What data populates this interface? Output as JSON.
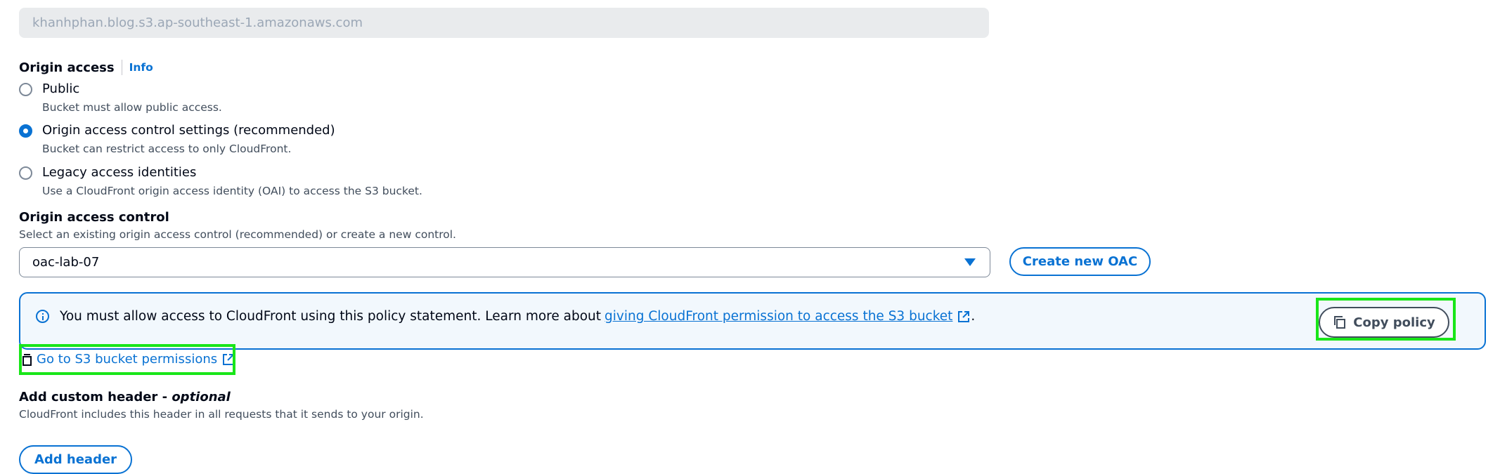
{
  "origin_domain": {
    "value": "khanhphan.blog.s3.ap-southeast-1.amazonaws.com"
  },
  "origin_access": {
    "label": "Origin access",
    "info": "Info",
    "options": [
      {
        "title": "Public",
        "desc": "Bucket must allow public access.",
        "checked": false
      },
      {
        "title": "Origin access control settings (recommended)",
        "desc": "Bucket can restrict access to only CloudFront.",
        "checked": true
      },
      {
        "title": "Legacy access identities",
        "desc": "Use a CloudFront origin access identity (OAI) to access the S3 bucket.",
        "checked": false
      }
    ]
  },
  "oac": {
    "label": "Origin access control",
    "desc": "Select an existing origin access control (recommended) or create a new control.",
    "selected": "oac-lab-07",
    "create_button": "Create new OAC"
  },
  "alert": {
    "text": "You must allow access to CloudFront using this policy statement. Learn more about ",
    "link_text": "giving CloudFront permission to access the S3 bucket",
    "trailing": ".",
    "copy_button": "Copy policy"
  },
  "s3_permissions_link": "Go to S3 bucket permissions",
  "custom_header": {
    "label": "Add custom header - ",
    "optional": "optional",
    "desc": "CloudFront includes this header in all requests that it sends to your origin.",
    "add_button": "Add header"
  },
  "colors": {
    "accent": "#0972d3",
    "highlight": "#19e619",
    "alert_bg": "#f2f8fd"
  }
}
